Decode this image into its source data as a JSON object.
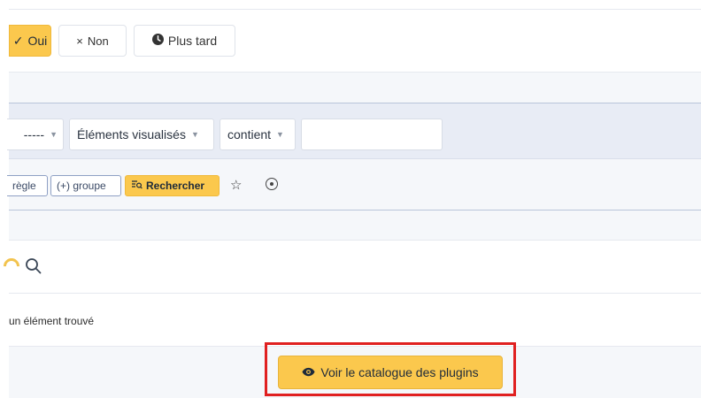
{
  "validation": {
    "yes_label": "Oui",
    "yes_check": "✓",
    "no_label": "Non",
    "no_icon": "×",
    "later_label": "Plus tard"
  },
  "search": {
    "dash_value": "-----",
    "field_value": "Éléments visualisés",
    "operator_value": "contient",
    "text_value": ""
  },
  "actions": {
    "rule_label": "règle",
    "group_label": "(+) groupe",
    "search_label": "Rechercher",
    "star": "☆"
  },
  "results": {
    "count_text": "un élément trouvé"
  },
  "footer": {
    "catalog_label": "Voir le catalogue des plugins"
  },
  "colors": {
    "accent": "#fbc84d",
    "highlight": "#e02020"
  }
}
